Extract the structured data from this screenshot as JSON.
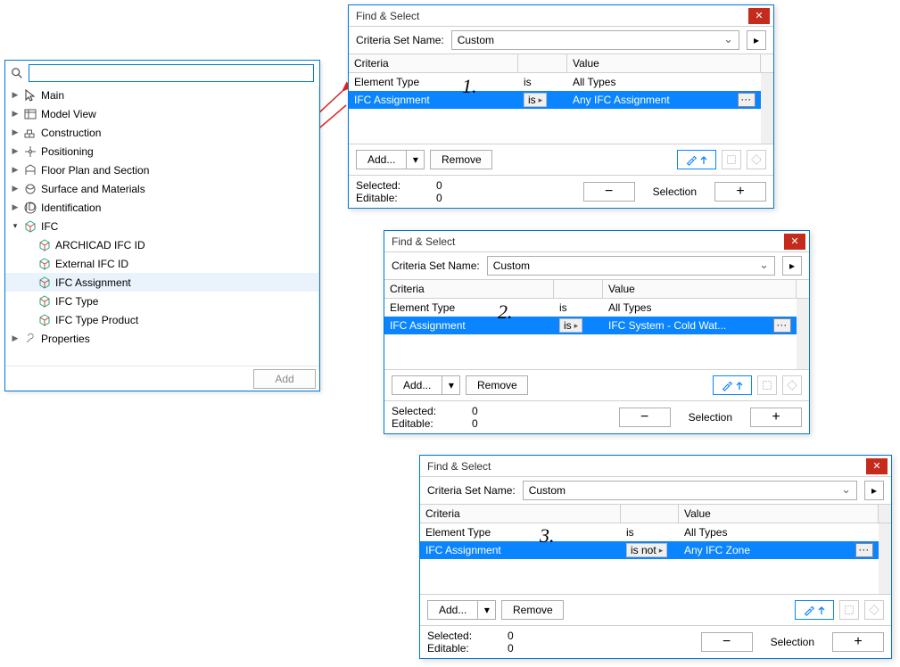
{
  "tree": {
    "search_placeholder": "",
    "items": [
      {
        "label": "Main"
      },
      {
        "label": "Model View"
      },
      {
        "label": "Construction"
      },
      {
        "label": "Positioning"
      },
      {
        "label": "Floor Plan and Section"
      },
      {
        "label": "Surface and Materials"
      },
      {
        "label": "Identification"
      },
      {
        "label": "IFC"
      },
      {
        "label": "ARCHICAD IFC ID"
      },
      {
        "label": "External IFC ID"
      },
      {
        "label": "IFC Assignment"
      },
      {
        "label": "IFC Type"
      },
      {
        "label": "IFC Type Product"
      },
      {
        "label": "Properties"
      }
    ],
    "footer_add": "Add"
  },
  "dialogs": [
    {
      "title": "Find & Select",
      "criteria_set_label": "Criteria Set Name:",
      "criteria_set_value": "Custom",
      "col_criteria": "Criteria",
      "col_value": "Value",
      "row_type_label": "Element Type",
      "row_type_op": "is",
      "row_type_value": "All Types",
      "row_assign_label": "IFC Assignment",
      "row_assign_op": "is",
      "row_assign_value": "Any IFC Assignment",
      "add": "Add...",
      "remove": "Remove",
      "selected_label": "Selected:",
      "selected_value": "0",
      "editable_label": "Editable:",
      "editable_value": "0",
      "selection_label": "Selection"
    },
    {
      "title": "Find & Select",
      "criteria_set_label": "Criteria Set Name:",
      "criteria_set_value": "Custom",
      "col_criteria": "Criteria",
      "col_value": "Value",
      "row_type_label": "Element Type",
      "row_type_op": "is",
      "row_type_value": "All Types",
      "row_assign_label": "IFC Assignment",
      "row_assign_op": "is",
      "row_assign_value": "IFC System - Cold Wat...",
      "add": "Add...",
      "remove": "Remove",
      "selected_label": "Selected:",
      "selected_value": "0",
      "editable_label": "Editable:",
      "editable_value": "0",
      "selection_label": "Selection"
    },
    {
      "title": "Find & Select",
      "criteria_set_label": "Criteria Set Name:",
      "criteria_set_value": "Custom",
      "col_criteria": "Criteria",
      "col_value": "Value",
      "row_type_label": "Element Type",
      "row_type_op": "is",
      "row_type_value": "All Types",
      "row_assign_label": "IFC Assignment",
      "row_assign_op": "is not",
      "row_assign_value": "Any IFC Zone",
      "add": "Add...",
      "remove": "Remove",
      "selected_label": "Selected:",
      "selected_value": "0",
      "editable_label": "Editable:",
      "editable_value": "0",
      "selection_label": "Selection"
    }
  ],
  "annotations": [
    "1.",
    "2.",
    "3."
  ]
}
